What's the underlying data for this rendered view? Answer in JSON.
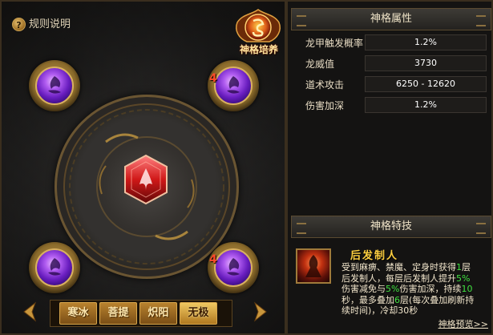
{
  "left_panel": {
    "help_icon": "question-icon",
    "help_text": "规则说明",
    "emblem_label": "神格培养",
    "orbs": [
      {
        "name": "orb-top-left",
        "badge": ""
      },
      {
        "name": "orb-top-right",
        "badge": "4"
      },
      {
        "name": "orb-bottom-left",
        "badge": ""
      },
      {
        "name": "orb-bottom-right",
        "badge": "4"
      }
    ],
    "tabs": [
      {
        "label": "寒冰",
        "active": false
      },
      {
        "label": "菩提",
        "active": false
      },
      {
        "label": "炽阳",
        "active": false
      },
      {
        "label": "无极",
        "active": true
      }
    ]
  },
  "right_panel": {
    "attributes_header": "神格属性",
    "attributes": [
      {
        "label": "龙甲触发概率",
        "value": "1.2%"
      },
      {
        "label": "龙威值",
        "value": "3730"
      },
      {
        "label": "道术攻击",
        "value": "6250 - 12620"
      },
      {
        "label": "伤害加深",
        "value": "1.2%"
      }
    ],
    "skill_header": "神格特技",
    "skill": {
      "name": "后发制人",
      "desc_parts": [
        {
          "text": "受到麻痹、禁魔、定身时获得",
          "green": false
        },
        {
          "text": "1",
          "green": true
        },
        {
          "text": "层后发制人，每层后发制人提升",
          "green": false
        },
        {
          "text": "5%",
          "green": true
        },
        {
          "text": "伤害减免与",
          "green": false
        },
        {
          "text": "5%",
          "green": true
        },
        {
          "text": "伤害加深，持续",
          "green": false
        },
        {
          "text": "10",
          "green": true
        },
        {
          "text": "秒，最多叠加",
          "green": false
        },
        {
          "text": "6",
          "green": true
        },
        {
          "text": "层(每次叠加刷新持续时间)，冷却30秒",
          "green": false
        }
      ]
    },
    "preview_link": "神格预览>>"
  },
  "colors": {
    "accent_gold": "#d7a64c",
    "gem_purple": "#6a1ec0",
    "highlight_green": "#40e040",
    "badge_red": "#ff4a2a"
  }
}
